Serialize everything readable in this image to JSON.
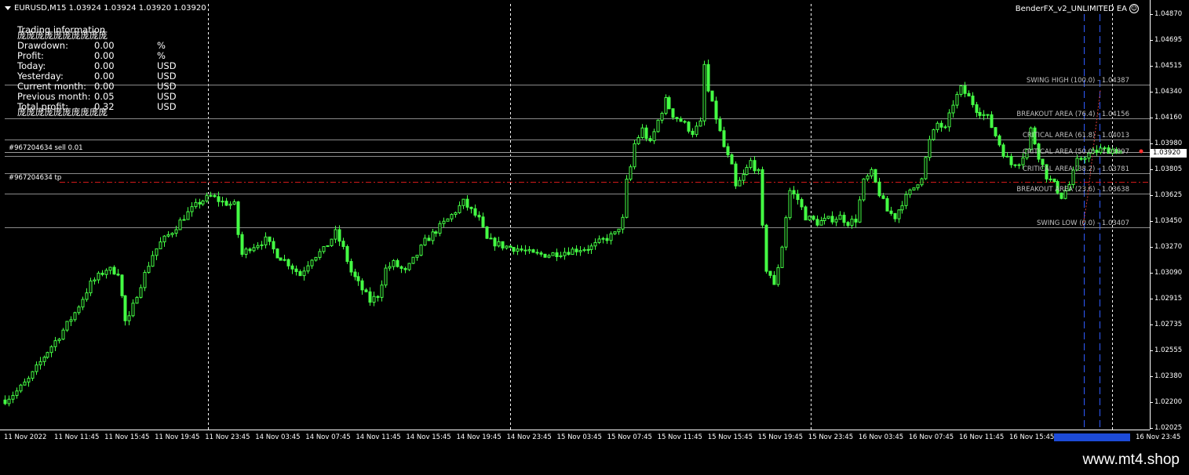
{
  "chart": {
    "symbol_header": "EURUSD,M15  1.03924 1.03924 1.03920 1.03920",
    "expert_name": "BenderFX_v2_UNLIMITED EA",
    "expert_icon": "smiley-icon",
    "current_price": "1.03920"
  },
  "info_panel": {
    "title": "Trading information",
    "separator": "庞庞庞庞庞庞庞庞庞庞",
    "rows": [
      {
        "label": "Drawdown:",
        "value": "0.00",
        "unit": "%"
      },
      {
        "label": "Profit:",
        "value": "0.00",
        "unit": "%"
      },
      {
        "label": "Today:",
        "value": "0.00",
        "unit": "USD"
      },
      {
        "label": "Yesterday:",
        "value": "0.00",
        "unit": "USD"
      },
      {
        "label": "Current month:",
        "value": "0.00",
        "unit": "USD"
      },
      {
        "label": "Previous month:",
        "value": "0.05",
        "unit": "USD"
      },
      {
        "label": "Total profit:",
        "value": "0.32",
        "unit": "USD"
      }
    ]
  },
  "orders": [
    {
      "label": "#967204634 sell 0.01",
      "price": 1.03925
    },
    {
      "label": "#967204634 tp",
      "price": 1.0372
    }
  ],
  "fibo_levels": [
    {
      "label": "SWING HIGH (100.0) - 1.04387",
      "price": 1.04387
    },
    {
      "label": "BREAKOUT AREA (76.4) - 1.04156",
      "price": 1.04156
    },
    {
      "label": "CRITICAL AREA (61.8) - 1.04013",
      "price": 1.04013
    },
    {
      "label": "CRITICAL AREA (50.0) - 1.03897",
      "price": 1.03897
    },
    {
      "label": "CRITICAL AREA (38.2) - 1.03781",
      "price": 1.03781
    },
    {
      "label": "BREAKOUT AREA (23.6) - 1.03638",
      "price": 1.03638
    },
    {
      "label": "SWING LOW (0.0) - 1.03407",
      "price": 1.03407
    }
  ],
  "price_axis": [
    "1.04870",
    "1.04695",
    "1.04515",
    "1.04340",
    "1.04160",
    "1.03980",
    "1.03805",
    "1.03625",
    "1.03450",
    "1.03270",
    "1.03090",
    "1.02915",
    "1.02735",
    "1.02555",
    "1.02380",
    "1.02200",
    "1.02025"
  ],
  "time_axis": [
    "11 Nov 2022",
    "11 Nov 11:45",
    "11 Nov 15:45",
    "11 Nov 19:45",
    "11 Nov 23:45",
    "14 Nov 03:45",
    "14 Nov 07:45",
    "14 Nov 11:45",
    "14 Nov 15:45",
    "14 Nov 19:45",
    "14 Nov 23:45",
    "15 Nov 03:45",
    "15 Nov 07:45",
    "15 Nov 11:45",
    "15 Nov 15:45",
    "15 Nov 19:45",
    "15 Nov 23:45",
    "16 Nov 03:45",
    "16 Nov 07:45",
    "16 Nov 11:45",
    "16 Nov 15:45",
    "16 Nov 23:45"
  ],
  "chart_data": {
    "type": "candlestick",
    "ylim": [
      1.01985,
      1.04915
    ],
    "price_path": [
      [
        0,
        1.0222
      ],
      [
        3,
        1.0228
      ],
      [
        6,
        1.0236
      ],
      [
        10,
        1.0252
      ],
      [
        14,
        1.0266
      ],
      [
        18,
        1.0282
      ],
      [
        22,
        1.0302
      ],
      [
        26,
        1.0312
      ],
      [
        29,
        1.031
      ],
      [
        31,
        1.0276
      ],
      [
        32,
        1.0278
      ],
      [
        34,
        1.0295
      ],
      [
        38,
        1.0322
      ],
      [
        40,
        1.033
      ],
      [
        43,
        1.0338
      ],
      [
        46,
        1.0348
      ],
      [
        50,
        1.0358
      ],
      [
        53,
        1.0362
      ],
      [
        56,
        1.0358
      ],
      [
        59,
        1.0356
      ],
      [
        60,
        1.0336
      ],
      [
        61,
        1.0322
      ],
      [
        63,
        1.0327
      ],
      [
        67,
        1.0332
      ],
      [
        70,
        1.0322
      ],
      [
        73,
        1.0316
      ],
      [
        76,
        1.0308
      ],
      [
        79,
        1.032
      ],
      [
        82,
        1.0325
      ],
      [
        85,
        1.0337
      ],
      [
        87,
        1.0326
      ],
      [
        89,
        1.031
      ],
      [
        92,
        1.0298
      ],
      [
        94,
        1.029
      ],
      [
        96,
        1.0294
      ],
      [
        98,
        1.0312
      ],
      [
        100,
        1.0316
      ],
      [
        103,
        1.031
      ],
      [
        106,
        1.0322
      ],
      [
        108,
        1.0331
      ],
      [
        110,
        1.0336
      ],
      [
        114,
        1.0346
      ],
      [
        118,
        1.0358
      ],
      [
        120,
        1.0352
      ],
      [
        122,
        1.0346
      ],
      [
        124,
        1.0332
      ],
      [
        128,
        1.0328
      ],
      [
        132,
        1.0326
      ],
      [
        136,
        1.0322
      ],
      [
        140,
        1.0322
      ],
      [
        144,
        1.0324
      ],
      [
        148,
        1.0326
      ],
      [
        151,
        1.0327
      ],
      [
        154,
        1.0332
      ],
      [
        157,
        1.0336
      ],
      [
        159,
        1.0346
      ],
      [
        160,
        1.0372
      ],
      [
        161,
        1.0382
      ],
      [
        162,
        1.0398
      ],
      [
        164,
        1.0408
      ],
      [
        166,
        1.0398
      ],
      [
        168,
        1.0414
      ],
      [
        170,
        1.0428
      ],
      [
        172,
        1.0418
      ],
      [
        174,
        1.0414
      ],
      [
        177,
        1.0406
      ],
      [
        179,
        1.0412
      ],
      [
        180,
        1.0452
      ],
      [
        181,
        1.0434
      ],
      [
        183,
        1.0416
      ],
      [
        185,
        1.0396
      ],
      [
        187,
        1.0382
      ],
      [
        188,
        1.0368
      ],
      [
        190,
        1.0376
      ],
      [
        192,
        1.0386
      ],
      [
        194,
        1.0378
      ],
      [
        195,
        1.034
      ],
      [
        196,
        1.0312
      ],
      [
        197,
        1.0308
      ],
      [
        198,
        1.03
      ],
      [
        199,
        1.0314
      ],
      [
        200,
        1.0328
      ],
      [
        201,
        1.0348
      ],
      [
        202,
        1.0366
      ],
      [
        204,
        1.036
      ],
      [
        206,
        1.0348
      ],
      [
        209,
        1.0344
      ],
      [
        212,
        1.0346
      ],
      [
        215,
        1.0348
      ],
      [
        217,
        1.0344
      ],
      [
        219,
        1.0346
      ],
      [
        221,
        1.0372
      ],
      [
        223,
        1.0378
      ],
      [
        225,
        1.0364
      ],
      [
        227,
        1.0352
      ],
      [
        229,
        1.0348
      ],
      [
        231,
        1.0358
      ],
      [
        234,
        1.0368
      ],
      [
        236,
        1.0376
      ],
      [
        238,
        1.04
      ],
      [
        240,
        1.0412
      ],
      [
        242,
        1.0408
      ],
      [
        244,
        1.0426
      ],
      [
        246,
        1.0436
      ],
      [
        248,
        1.043
      ],
      [
        250,
        1.0422
      ],
      [
        253,
        1.0416
      ],
      [
        255,
        1.0404
      ],
      [
        257,
        1.0392
      ],
      [
        259,
        1.0384
      ],
      [
        261,
        1.0386
      ],
      [
        263,
        1.0394
      ],
      [
        264,
        1.0408
      ],
      [
        266,
        1.039
      ],
      [
        268,
        1.0376
      ],
      [
        270,
        1.037
      ],
      [
        272,
        1.0362
      ],
      [
        274,
        1.037
      ],
      [
        276,
        1.0386
      ],
      [
        278,
        1.039
      ],
      [
        280,
        1.0392
      ],
      [
        282,
        1.0394
      ],
      [
        285,
        1.0394
      ],
      [
        287,
        1.0393
      ]
    ]
  },
  "watermark": "www.mt4.shop"
}
